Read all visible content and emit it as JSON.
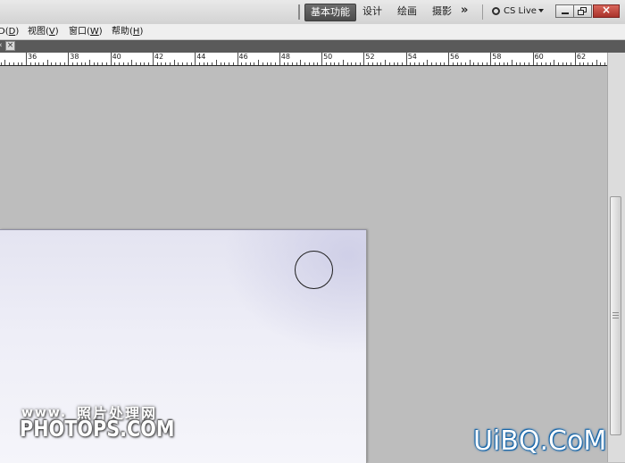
{
  "workspace": {
    "buttons": [
      {
        "label": "基本功能",
        "active": true
      },
      {
        "label": "设计",
        "active": false
      },
      {
        "label": "绘画",
        "active": false
      },
      {
        "label": "摄影",
        "active": false
      }
    ],
    "more_glyph": "»",
    "cs_live": "CS Live"
  },
  "menu": {
    "items": [
      {
        "prefix": "",
        "label": "D(",
        "key": "D",
        "suffix": ")"
      },
      {
        "prefix": "",
        "label": "视图(",
        "key": "V",
        "suffix": ")"
      },
      {
        "prefix": "",
        "label": "窗口(",
        "key": "W",
        "suffix": ")"
      },
      {
        "prefix": "",
        "label": "帮助(",
        "key": "H",
        "suffix": ")"
      }
    ]
  },
  "tab": {
    "chevron": "«",
    "close_glyph": "×"
  },
  "ruler": {
    "labels": [
      "36",
      "38",
      "40",
      "42",
      "44",
      "46",
      "48",
      "50",
      "52",
      "54",
      "56",
      "58",
      "60",
      "62"
    ]
  },
  "watermarks": {
    "www": "www.",
    "cn": "照片处理网",
    "photops": "PHOTOPS.COM",
    "uibq": "UiBQ.CoM"
  },
  "colors": {
    "active_workspace": "#555555",
    "canvas": "#ececf6",
    "workspace_bg": "#bdbdbd",
    "close_button": "#c0443a"
  }
}
